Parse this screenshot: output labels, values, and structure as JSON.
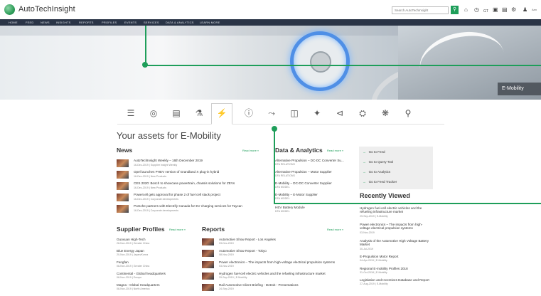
{
  "header": {
    "brand": "AutoTechInsight",
    "search_placeholder": "Search AutoTechInsight",
    "search_button_icon": "search-icon",
    "toolbar_icons": [
      "home-icon",
      "history-icon",
      "user-icon",
      "screen-icon",
      "document-icon",
      "gear-icon",
      "person-icon"
    ],
    "toolbar_text": "GT",
    "user_label": "Aen"
  },
  "nav": {
    "items": [
      "HOME",
      "FEED",
      "NEWS",
      "INSIGHTS",
      "REPORTS",
      "PROFILES",
      "EVENTS",
      "SERVICES",
      "DATA & ANALYTICS",
      "LEARN MORE"
    ]
  },
  "hero": {
    "label": "E-Mobility",
    "accent_color": "#1e9e5a"
  },
  "categories": {
    "icons": [
      "menu-icon",
      "globe-icon",
      "document-list-icon",
      "seat-icon",
      "emobility-icon",
      "info-icon",
      "seat-side-icon",
      "battery-icon",
      "network-icon",
      "wiper-icon",
      "engine-icon",
      "wheel-icon",
      "spark-plug-icon"
    ],
    "active_index": 4
  },
  "page_title": "Your assets for E-Mobility",
  "news": {
    "title": "News",
    "read_more": "Read more »",
    "items": [
      {
        "title": "AutoTechInsight Weekly – 16th December 2019",
        "meta": "16-Dec-2019 | Supplier Insight Weekly"
      },
      {
        "title": "Opel launches PHEV version of Grandland X plug-in hybrid",
        "meta": "16-Dec-2019 | New Products"
      },
      {
        "title": "CES 2020: Bosch to showcase powertrain, chassis solutions for ZEVs",
        "meta": "16-Dec-2019 | New Products"
      },
      {
        "title": "Powercell gets approval for phase 2 of fuel cell stack project",
        "meta": "16-Dec-2019 | Corporate developments"
      },
      {
        "title": "Porsche partners with Electrify Canada for EV charging services for Taycan",
        "meta": "16-Dec-2019 | Corporate developments"
      }
    ]
  },
  "data_analytics": {
    "title": "Data & Analytics",
    "read_more": "Read more »",
    "items": [
      {
        "title": "Alternative Propulsion – DC-DC Converter Su...",
        "meta": "DFA RELATIONS"
      },
      {
        "title": "Alternative Propulsion – Motor Supplier",
        "meta": "DFA RELATIONS"
      },
      {
        "title": "E-Mobility – DC-DC Converter Supplier",
        "meta": "DFA MODEL"
      },
      {
        "title": "E-Mobility – E-Motor Supplier",
        "meta": "DFA MODEL"
      },
      {
        "title": "HEV Battery Module",
        "meta": "DFA MODEL"
      }
    ]
  },
  "quick_links": [
    "Go to Feed",
    "Go to Query Tool",
    "Go to Analytics",
    "Go to Feed Tracker"
  ],
  "recently_viewed": {
    "title": "Recently Viewed",
    "items": [
      {
        "title": "Hydrogen fuel-cell electric vehicles and the refueling infrastructure market",
        "meta": "29-Sep-2019 | E-Mobility"
      },
      {
        "title": "Power electronics – The impacts from high-voltage electrical propulsion systems",
        "meta": "03-Nov-2019"
      },
      {
        "title": "Analysis of the Automotive High Voltage Battery Market",
        "meta": "30-Jul-2019"
      },
      {
        "title": "E-Propulsion Motor Report",
        "meta": "04-Apr-2019 | E-Mobility"
      },
      {
        "title": "Regional E-mobility Profiles 2018",
        "meta": "31-Oct-2018 | E-Mobility"
      },
      {
        "title": "Legislation and Incentives Database and Report",
        "meta": "27-Aug-2019 | E-Mobility"
      }
    ]
  },
  "supplier_profiles": {
    "title": "Supplier Profiles",
    "read_more": "Read more »",
    "items": [
      {
        "title": "Guoxuan High-Tech",
        "meta": "28-Nov-2019 | Greater China"
      },
      {
        "title": "Blue Energy Japan",
        "meta": "20-Nov-2019 | Japan/Korea"
      },
      {
        "title": "Fengfan",
        "meta": "08-Nov-2019 | Greater China"
      },
      {
        "title": "Continental - Global headquarters",
        "meta": "08-Nov-2019 | Europe"
      },
      {
        "title": "Magna - Global Headquarters",
        "meta": "08-Nov-2019 | North America"
      }
    ]
  },
  "reports": {
    "title": "Reports",
    "read_more": "Read more »",
    "items": [
      {
        "title": "Automotive Show Report - Los Angeles",
        "meta": "03-Dec-2019"
      },
      {
        "title": "Automotive Show Report - Tokyo",
        "meta": "08-Nov-2019"
      },
      {
        "title": "Power electronics – The impacts from high-voltage electrical propulsion systems",
        "meta": "03-Nov-2019"
      },
      {
        "title": "Hydrogen fuel-cell electric vehicles and the refueling infrastructure market",
        "meta": "29-Sep-2019 | E-Mobility"
      },
      {
        "title": "Rail Automotive Client Briefing - Detroit - Presentations",
        "meta": "24-Sep-2019"
      }
    ]
  }
}
